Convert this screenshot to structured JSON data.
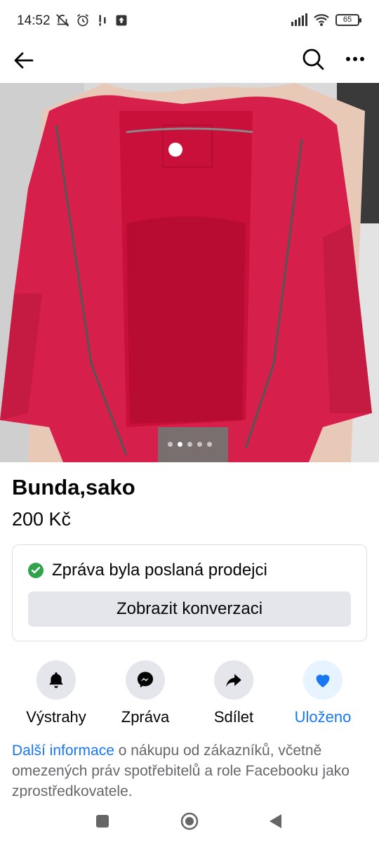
{
  "status_bar": {
    "time": "14:52",
    "battery": "65",
    "icons_left": [
      "mute-icon",
      "alarm-icon",
      "notification-icon",
      "upload-icon"
    ],
    "icons_right": [
      "signal-icon",
      "wifi-icon",
      "battery-icon"
    ]
  },
  "top_nav": {
    "icons": [
      "back-arrow-icon",
      "search-icon",
      "more-icon"
    ]
  },
  "photo": {
    "dot_count": 5,
    "active_index": 1,
    "colors": {
      "jacket": "#d61f4a",
      "lining": "#c8103a",
      "background": "#d6d6d6"
    }
  },
  "listing": {
    "title": "Bunda,sako",
    "price": "200 Kč"
  },
  "message_card": {
    "status_text": "Zpráva byla poslaná prodejci",
    "button_label": "Zobrazit konverzaci"
  },
  "actions": [
    {
      "label": "Výstrahy",
      "icon": "bell-icon"
    },
    {
      "label": "Zpráva",
      "icon": "messenger-icon"
    },
    {
      "label": "Sdílet",
      "icon": "share-icon"
    },
    {
      "label": "Uloženo",
      "icon": "heart-icon"
    }
  ],
  "info": {
    "link_text": "Další informace",
    "rest_text": " o nákupu od zákazníků, včetně omezených práv spotřebitelů a role Facebooku jako zprostředkovatele."
  },
  "colors": {
    "accent": "#1877f2",
    "success": "#31a24c",
    "button_bg": "#e4e6eb",
    "muted_text": "#65676b"
  }
}
